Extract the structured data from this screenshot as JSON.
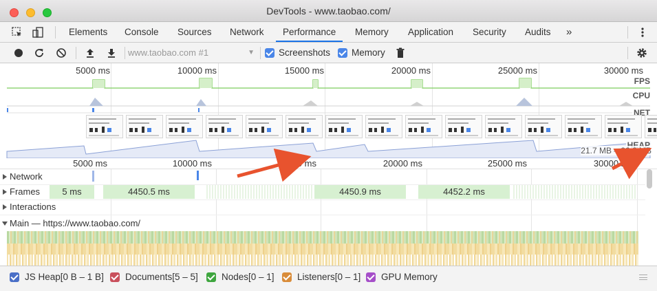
{
  "window": {
    "title": "DevTools - www.taobao.com/"
  },
  "tabs": [
    {
      "label": "Elements"
    },
    {
      "label": "Console"
    },
    {
      "label": "Sources"
    },
    {
      "label": "Network"
    },
    {
      "label": "Performance",
      "active": true
    },
    {
      "label": "Memory"
    },
    {
      "label": "Application"
    },
    {
      "label": "Security"
    },
    {
      "label": "Audits"
    }
  ],
  "tab_overflow": "»",
  "toolbar": {
    "recording_select": "www.taobao.com #1",
    "screenshots_label": "Screenshots",
    "screenshots_checked": true,
    "memory_label": "Memory",
    "memory_checked": true
  },
  "overview": {
    "ticks": [
      "5000 ms",
      "10000 ms",
      "15000 ms",
      "20000 ms",
      "25000 ms",
      "30000 ms"
    ],
    "lanes": {
      "fps": "FPS",
      "cpu": "CPU",
      "net": "NET",
      "heap": "HEAP"
    },
    "heap_readout": "21.7 MB – 22.8 MB"
  },
  "ruler": {
    "ticks": [
      "5000 ms",
      "10000 ms",
      "15000 ms",
      "20000 ms",
      "25000 ms",
      "30000 ms"
    ]
  },
  "tracks": {
    "network": "Network",
    "frames": "Frames",
    "frame_values": [
      "5 ms",
      "4450.5 ms",
      "4450.9 ms",
      "4452.2 ms"
    ],
    "interactions": "Interactions",
    "main": "Main — https://www.taobao.com/"
  },
  "legend": [
    {
      "label": "JS Heap[0 B – 1 B]",
      "color": "#4a6fc7"
    },
    {
      "label": "Documents[5 – 5]",
      "color": "#c9505c"
    },
    {
      "label": "Nodes[0 – 1]",
      "color": "#3fa63f"
    },
    {
      "label": "Listeners[0 – 1]",
      "color": "#d98c3a"
    },
    {
      "label": "GPU Memory",
      "color": "#a64fc9"
    }
  ],
  "colors": {
    "accent": "#1a73e8",
    "checkbox": "#4a86e8",
    "frame_green": "#d7f0d1",
    "annotation_arrow": "#e8532e"
  }
}
